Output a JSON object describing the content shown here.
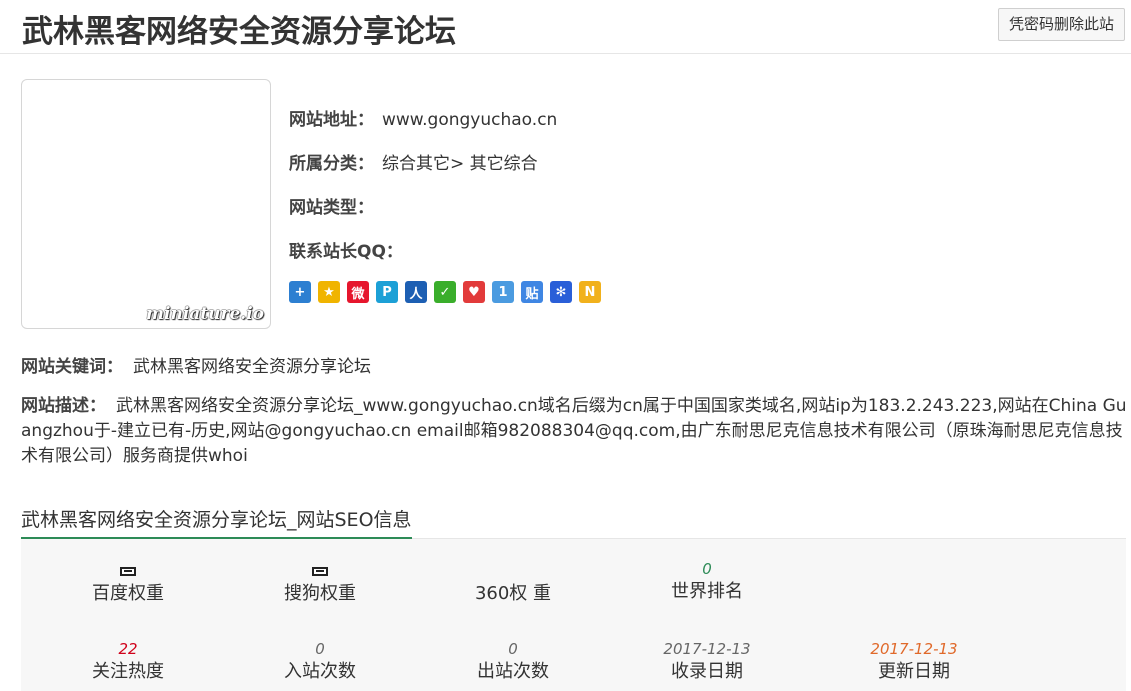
{
  "header": {
    "title": "武林黑客网络安全资源分享论坛",
    "delete_button": "凭密码删除此站"
  },
  "thumbnail": {
    "watermark": "miniature.io"
  },
  "info": {
    "address_label": "网站地址：",
    "address_value": "www.gongyuchao.cn",
    "category_label": "所属分类：",
    "category_value": "综合其它> 其它综合",
    "type_label": "网站类型：",
    "qq_label": "联系站长QQ："
  },
  "share_icons": [
    {
      "name": "plus-share-icon",
      "glyph": "+",
      "color": "#2d7fd1"
    },
    {
      "name": "qzone-icon",
      "glyph": "★",
      "color": "#f0b400"
    },
    {
      "name": "weibo-icon",
      "glyph": "微",
      "color": "#e6162d"
    },
    {
      "name": "tencent-weibo-icon",
      "glyph": "P",
      "color": "#1ca0d6"
    },
    {
      "name": "renren-icon",
      "glyph": "人",
      "color": "#1d5fb3"
    },
    {
      "name": "wechat-icon",
      "glyph": "✓",
      "color": "#3aae2b"
    },
    {
      "name": "heart-icon",
      "glyph": "♥",
      "color": "#e23b3b"
    },
    {
      "name": "one-icon",
      "glyph": "1",
      "color": "#4b9be0"
    },
    {
      "name": "tieba-icon",
      "glyph": "贴",
      "color": "#3f86e3"
    },
    {
      "name": "baidu-icon",
      "glyph": "✻",
      "color": "#2a5fd8"
    },
    {
      "name": "n-share-icon",
      "glyph": "N",
      "color": "#f1b11c"
    }
  ],
  "keywords": {
    "label": "网站关键词：",
    "value": "武林黑客网络安全资源分享论坛"
  },
  "description": {
    "label": "网站描述：",
    "value": "武林黑客网络安全资源分享论坛_www.gongyuchao.cn域名后缀为cn属于中国国家类域名,网站ip为183.2.243.223,网站在China Guangzhou于-建立已有-历史,网站@gongyuchao.cn email邮箱982088304@qq.com,由广东耐思尼克信息技术有限公司（原珠海耐思尼克信息技术有限公司）服务商提供whoi"
  },
  "seo": {
    "title": "武林黑客网络安全资源分享论坛_网站SEO信息",
    "baidu_weight_label": "百度权重",
    "sogou_weight_label": "搜狗权重",
    "weight_360_label": "360权 重",
    "world_rank_value": "0",
    "world_rank_label": "世界排名",
    "attention_value": "22",
    "attention_label": "关注热度",
    "inbound_value": "0",
    "inbound_label": "入站次数",
    "outbound_value": "0",
    "outbound_label": "出站次数",
    "indexed_date_value": "2017-12-13",
    "indexed_date_label": "收录日期",
    "updated_date_value": "2017-12-13",
    "updated_date_label": "更新日期"
  },
  "colors": {
    "accent_green": "#2d8b57",
    "world_rank": "#2d8b57",
    "attention": "#d0021b",
    "neutral_value": "#666666",
    "updated_date": "#e0692a"
  }
}
